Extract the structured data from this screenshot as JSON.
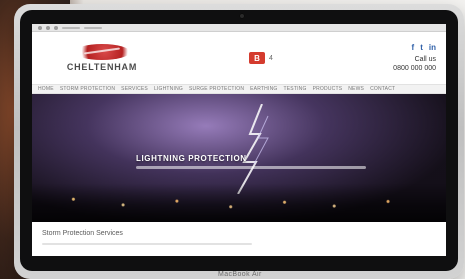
{
  "scene": {
    "background_accent": "#8a4a2b"
  },
  "site": {
    "logo_text": "CHELTENHAM",
    "badge_mark": "B",
    "badge_text": "4",
    "social": [
      "f",
      "t",
      "in"
    ],
    "contact_lines": [
      "Call us",
      "0800 000 000"
    ],
    "nav_items": [
      "Home",
      "Storm protection",
      "Services",
      "Lightning",
      "Surge protection",
      "Earthing",
      "Testing",
      "Products",
      "News",
      "Contact"
    ],
    "hero_title": "Lightning Protection",
    "content_title": "Storm Protection Services"
  },
  "device": {
    "brand_label": "MacBook Air"
  }
}
